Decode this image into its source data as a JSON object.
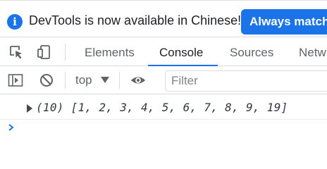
{
  "infobar": {
    "message": "DevTools is now available in Chinese!",
    "button_label": "Always match",
    "icon": "info-icon",
    "icon_glyph": "i"
  },
  "tabs": [
    {
      "label": "Elements",
      "active": false
    },
    {
      "label": "Console",
      "active": true
    },
    {
      "label": "Sources",
      "active": false
    },
    {
      "label": "Netw",
      "active": false
    }
  ],
  "toolbar": {
    "context_label": "top",
    "filter_placeholder": "Filter",
    "filter_value": ""
  },
  "console": {
    "log_line": "(10) [1, 2, 3, 4, 5, 6, 7, 8, 9, 19]"
  },
  "colors": {
    "accent": "#1a73e8",
    "text": "#202124",
    "muted": "#5f6368"
  }
}
